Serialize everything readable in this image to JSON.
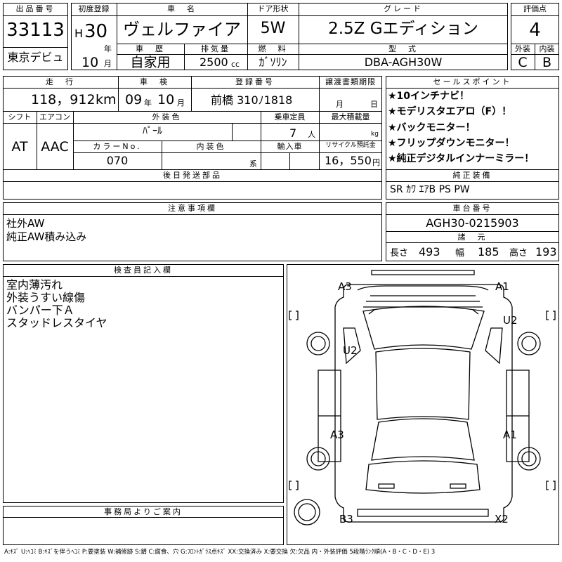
{
  "header": {
    "lot_no_label": "出品番号",
    "lot_no": "33113",
    "first_reg_label": "初度登録",
    "era": "H",
    "year": "30",
    "year_unit": "年",
    "month": "10",
    "month_unit": "月",
    "tokyo_debut": "東京デビュ",
    "car_name_label": "車　名",
    "car_name": "ヴェルファイア",
    "door_label": "ドア形状",
    "door": "5W",
    "grade_label": "グレード",
    "grade": "2.5Z Gエディション",
    "score_label": "評価点",
    "score": "4",
    "history_label": "車　歴",
    "history": "自家用",
    "displacement_label": "排気量",
    "displacement": "2500",
    "cc": "cc",
    "fuel_label": "燃　料",
    "fuel": "ｶﾞｿﾘﾝ",
    "model_label": "型　式",
    "model": "DBA-AGH30W",
    "exterior_label": "外装",
    "exterior": "C",
    "interior_label": "内装",
    "interior": "B"
  },
  "row2": {
    "mileage_label": "走　行",
    "mileage": "118，912",
    "km": "km",
    "inspection_label": "車　検",
    "insp_year": "09",
    "insp_month": "10",
    "year_unit": "年",
    "month_unit": "月",
    "reg_no_label": "登録番号",
    "reg_no": "前橋 310ﾉ1818",
    "transfer_label": "譲渡書類期限",
    "transfer_month": "月",
    "transfer_day": "日",
    "shift_label": "シフト",
    "shift": "AT",
    "ac_label": "エアコン",
    "ac": "AAC",
    "ext_color_label": "外装色",
    "ext_color": "ﾊﾟｰﾙ",
    "capacity_label": "乗車定員",
    "capacity": "7",
    "capacity_unit": "人",
    "load_label": "最大積載量",
    "load_unit": "kg",
    "color_no_label": "カラーNo.",
    "color_no": "070",
    "int_color_label": "内装色",
    "int_color_unit": "系",
    "import_label": "輸入車",
    "recycle_label": "リサイクル預託金",
    "recycle": "16，550",
    "recycle_unit": "円",
    "later_parts_label": "後日発送部品"
  },
  "sales_points": {
    "label": "セールスポイント",
    "items": [
      "★10インチナビ！",
      "★モデリスタエアロ（F）！",
      "★バックモニター！",
      "★フリップダウンモニター！",
      "★純正デジタルインナーミラー！"
    ]
  },
  "equipment": {
    "label": "純正装備",
    "value": "SR ｶﾜ ｴｱB PS PW"
  },
  "notes": {
    "label": "注意事項欄",
    "lines": [
      "社外AW",
      "純正AW積み込み"
    ]
  },
  "chassis": {
    "label": "車台番号",
    "value": "AGH30-0215903",
    "dims_label": "諸　元",
    "length_label": "長さ",
    "length": "493",
    "width_label": "幅",
    "width": "185",
    "height_label": "高さ",
    "height": "193"
  },
  "inspector": {
    "label": "検査員記入欄",
    "lines": [
      "室内薄汚れ",
      "外装うすい線傷",
      "バンパー下Ａ",
      "スタッドレスタイヤ"
    ]
  },
  "office": {
    "label": "事務局よりご案内"
  },
  "diagram": {
    "marks": {
      "a3_top": "A3",
      "a1_top": "A1",
      "u2_right": "U2",
      "u2_left": "U2",
      "a3_mid": "A3",
      "a1_mid": "A1",
      "b3": "B3",
      "x2": "X2"
    }
  },
  "legend": "A:ｷｽﾞ U:ﾍｺﾐ B:ｷｽﾞを伴うﾍｺﾐ P:要塗装 W:補修跡 S:錆 C:腐食、穴 G:ﾌﾛﾝﾄｶﾞﾗｽ点ｷｽﾞ XX:交換済み X:要交換 欠:欠品 内・外装評価 5段階ﾗﾝｸ順(A・B・C・D・E) 3"
}
